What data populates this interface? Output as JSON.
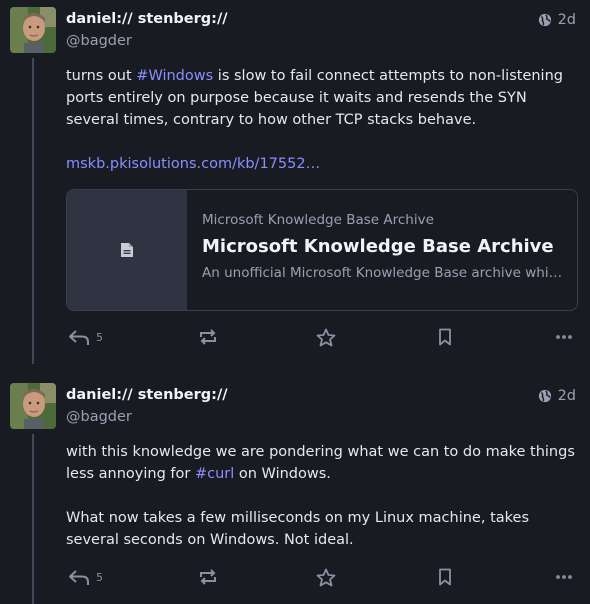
{
  "posts": [
    {
      "author_name": "daniel:// stenberg://",
      "author_handle": "@bagder",
      "time": "2d",
      "visibility_icon": "globe-icon",
      "text_before_tag": "turns out ",
      "hashtag": "#Windows",
      "text_after_tag": " is slow to fail connect attempts to non-listening ports entirely on purpose because it waits and resends the SYN several times, contrary to how other TCP stacks behave.",
      "link_text": "mskb.pkisolutions.com/kb/17552…",
      "card": {
        "provider": "Microsoft Knowledge Base Archive",
        "title": "Microsoft Knowledge Base Archive",
        "description": "An unofficial Microsoft Knowledge Base archive which is…"
      },
      "reply_count": "5"
    },
    {
      "author_name": "daniel:// stenberg://",
      "author_handle": "@bagder",
      "time": "2d",
      "visibility_icon": "globe-icon",
      "text_before_tag": "with this knowledge we are pondering what we can to do make things less annoying for ",
      "hashtag": "#curl",
      "text_after_tag": " on Windows.",
      "paragraph2": "What now takes a few milliseconds on my Linux machine, takes several seconds on Windows. Not ideal.",
      "reply_count": "5"
    }
  ],
  "colors": {
    "background": "#191b22",
    "accent": "#8c8dff",
    "muted": "#9aa0b1"
  }
}
